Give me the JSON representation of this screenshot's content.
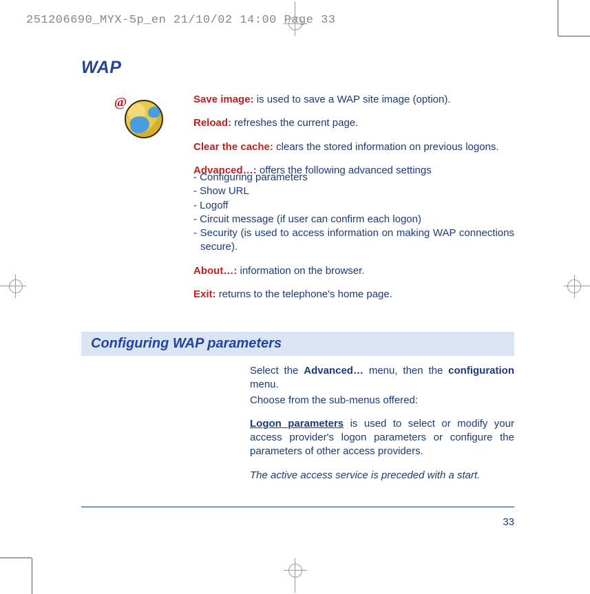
{
  "header_line": "251206690_MYX-5p_en  21/10/02  14:00  Page 33",
  "title": "WAP",
  "items": {
    "save_image": {
      "label": "Save image:",
      "text": "is used to save a WAP site image (option)."
    },
    "reload": {
      "label": "Reload:",
      "text": "refreshes the current page."
    },
    "clear_cache": {
      "label": "Clear the cache:",
      "text": "clears the stored information on previous logons."
    },
    "advanced": {
      "label": "Advanced…:",
      "text": "offers the following advanced settings"
    },
    "about": {
      "label": "About…:",
      "text": "information on the browser."
    },
    "exit": {
      "label": "Exit:",
      "text": "returns to the telephone's home page."
    }
  },
  "advanced_list": [
    "- Configuring parameters",
    "- Show URL",
    "- Logoff",
    "- Circuit message (if user can confirm each logon)",
    "- Security (is used to access information on making WAP connections secure)."
  ],
  "section_title": "Configuring WAP parameters",
  "section": {
    "line1_a": "Select the ",
    "line1_b": "Advanced…",
    "line1_c": " menu, then the ",
    "line1_d": "configuration",
    "line1_e": " menu.",
    "line2": "Choose from the sub-menus offered:",
    "logon_label": "Logon parameters",
    "logon_text": " is used to select or modify your access provider's logon parameters or configure the parameters of other access providers.",
    "italic_note": "The active access service is preceded with a start."
  },
  "page_number": "33"
}
